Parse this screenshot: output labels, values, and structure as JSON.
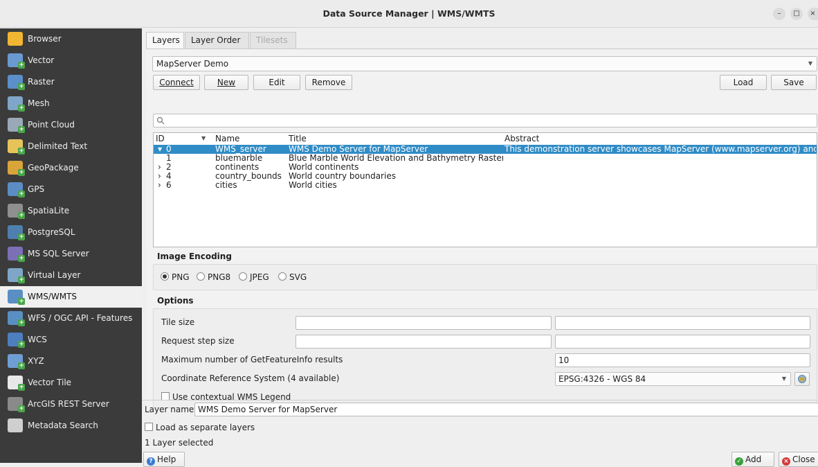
{
  "window": {
    "title": "Data Source Manager | WMS/WMTS"
  },
  "sidebar": {
    "items": [
      {
        "label": "Browser",
        "icon": "folder-icon",
        "color": "#f2b632"
      },
      {
        "label": "Vector",
        "icon": "vector-icon",
        "color": "#6a9ad1"
      },
      {
        "label": "Raster",
        "icon": "raster-icon",
        "color": "#5b8fc9"
      },
      {
        "label": "Mesh",
        "icon": "mesh-icon",
        "color": "#7fa5c8"
      },
      {
        "label": "Point Cloud",
        "icon": "point-cloud-icon",
        "color": "#9aa9b8"
      },
      {
        "label": "Delimited Text",
        "icon": "delimited-text-icon",
        "color": "#e6c45a"
      },
      {
        "label": "GeoPackage",
        "icon": "geopackage-icon",
        "color": "#d9a43a"
      },
      {
        "label": "GPS",
        "icon": "gps-icon",
        "color": "#5c8cc4"
      },
      {
        "label": "SpatiaLite",
        "icon": "spatialite-icon",
        "color": "#8f8f8f"
      },
      {
        "label": "PostgreSQL",
        "icon": "postgresql-icon",
        "color": "#4f7fae"
      },
      {
        "label": "MS SQL Server",
        "icon": "mssql-icon",
        "color": "#7c6fb5"
      },
      {
        "label": "Virtual Layer",
        "icon": "virtual-layer-icon",
        "color": "#7fa6c9"
      },
      {
        "label": "WMS/WMTS",
        "icon": "wms-globe-icon",
        "color": "#5a8fc3"
      },
      {
        "label": "WFS / OGC API - Features",
        "icon": "wfs-globe-icon",
        "color": "#5a8fc3"
      },
      {
        "label": "WCS",
        "icon": "wcs-globe-icon",
        "color": "#4d7fbf"
      },
      {
        "label": "XYZ",
        "icon": "xyz-grid-icon",
        "color": "#6f9ed4"
      },
      {
        "label": "Vector Tile",
        "icon": "vector-tile-icon",
        "color": "#e8e8e8"
      },
      {
        "label": "ArcGIS REST Server",
        "icon": "arcgis-icon",
        "color": "#8a8a8a"
      },
      {
        "label": "Metadata Search",
        "icon": "search-icon",
        "color": "#cfcfcf"
      }
    ],
    "selected_index": 12
  },
  "tabs": [
    {
      "label": "Layers",
      "state": "active"
    },
    {
      "label": "Layer Order",
      "state": "normal"
    },
    {
      "label": "Tilesets",
      "state": "disabled"
    }
  ],
  "connection": {
    "selected": "MapServer Demo"
  },
  "buttons": {
    "connect": "Connect",
    "new": "New",
    "edit": "Edit",
    "remove": "Remove",
    "load": "Load",
    "save": "Save"
  },
  "search": {
    "placeholder": ""
  },
  "tree": {
    "columns": [
      "ID",
      "Name",
      "Title",
      "Abstract"
    ],
    "rows": [
      {
        "expander": "▾",
        "id": "0",
        "name": "WMS_server",
        "title": "WMS Demo Server for MapServer",
        "abstract": "This demonstration server showcases MapServer (www.mapserver.org) and...",
        "selected": true
      },
      {
        "expander": "",
        "id": "1",
        "name": "bluemarble",
        "title": "Blue Marble World Elevation and Bathymetry Raster",
        "abstract": "",
        "selected": false
      },
      {
        "expander": "›",
        "id": "2",
        "name": "continents",
        "title": "World continents",
        "abstract": "",
        "selected": false
      },
      {
        "expander": "›",
        "id": "4",
        "name": "country_bounds",
        "title": "World country boundaries",
        "abstract": "",
        "selected": false
      },
      {
        "expander": "›",
        "id": "6",
        "name": "cities",
        "title": "World cities",
        "abstract": "",
        "selected": false
      }
    ]
  },
  "encoding": {
    "title": "Image Encoding",
    "options": [
      {
        "label": "PNG",
        "checked": true
      },
      {
        "label": "PNG8",
        "checked": false
      },
      {
        "label": "JPEG",
        "checked": false
      },
      {
        "label": "SVG",
        "checked": false
      }
    ]
  },
  "options": {
    "title": "Options",
    "tile_size_label": "Tile size",
    "request_step_label": "Request step size",
    "max_getfeatureinfo_label": "Maximum number of GetFeatureInfo results",
    "max_getfeatureinfo_value": "10",
    "crs_label": "Coordinate Reference System (4 available)",
    "crs_value": "EPSG:4326 - WGS 84",
    "contextual_legend_label": "Use contextual WMS Legend"
  },
  "layer_name": {
    "label": "Layer name",
    "value": "WMS Demo Server for MapServer"
  },
  "load_separate_label": "Load as separate layers",
  "status": "1 Layer selected",
  "footer": {
    "help": "Help",
    "add": "Add",
    "close": "Close"
  },
  "colors": {
    "selection": "#308cc6",
    "sidebar_bg": "#3b3b3b",
    "add_green": "#3aa13a",
    "close_red": "#d33b3b",
    "help_blue": "#3a7bd5"
  }
}
